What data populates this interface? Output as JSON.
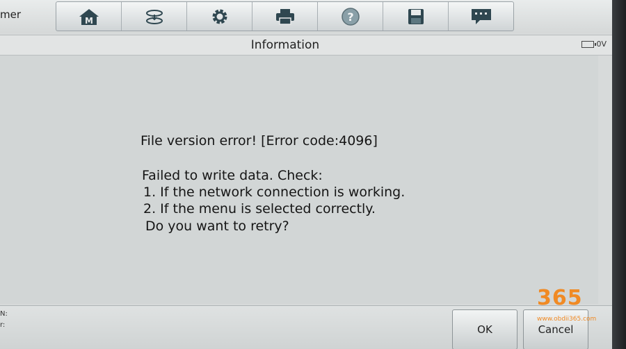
{
  "app": {
    "name_fragment": "mer"
  },
  "toolbar": {
    "icons": [
      "home-icon",
      "vehicle-swap-icon",
      "settings-icon",
      "print-icon",
      "help-icon",
      "save-icon",
      "message-icon"
    ]
  },
  "titlebar": {
    "title": "Information",
    "voltage": "0V"
  },
  "message": {
    "error": "File version error! [Error code:4096]",
    "line1": "Failed to write data. Check:",
    "line2": "1. If the network connection is working.",
    "line3": "2. If the menu is selected correctly.",
    "line4": "Do you want to retry?"
  },
  "bottom": {
    "label1": "N:",
    "label2": "r:",
    "ok_label": "OK",
    "cancel_label": "Cancel"
  },
  "watermark": {
    "brand": "365",
    "url": "www.obdii365.com"
  },
  "colors": {
    "accent": "#f08a24",
    "icon": "#2f4750"
  }
}
